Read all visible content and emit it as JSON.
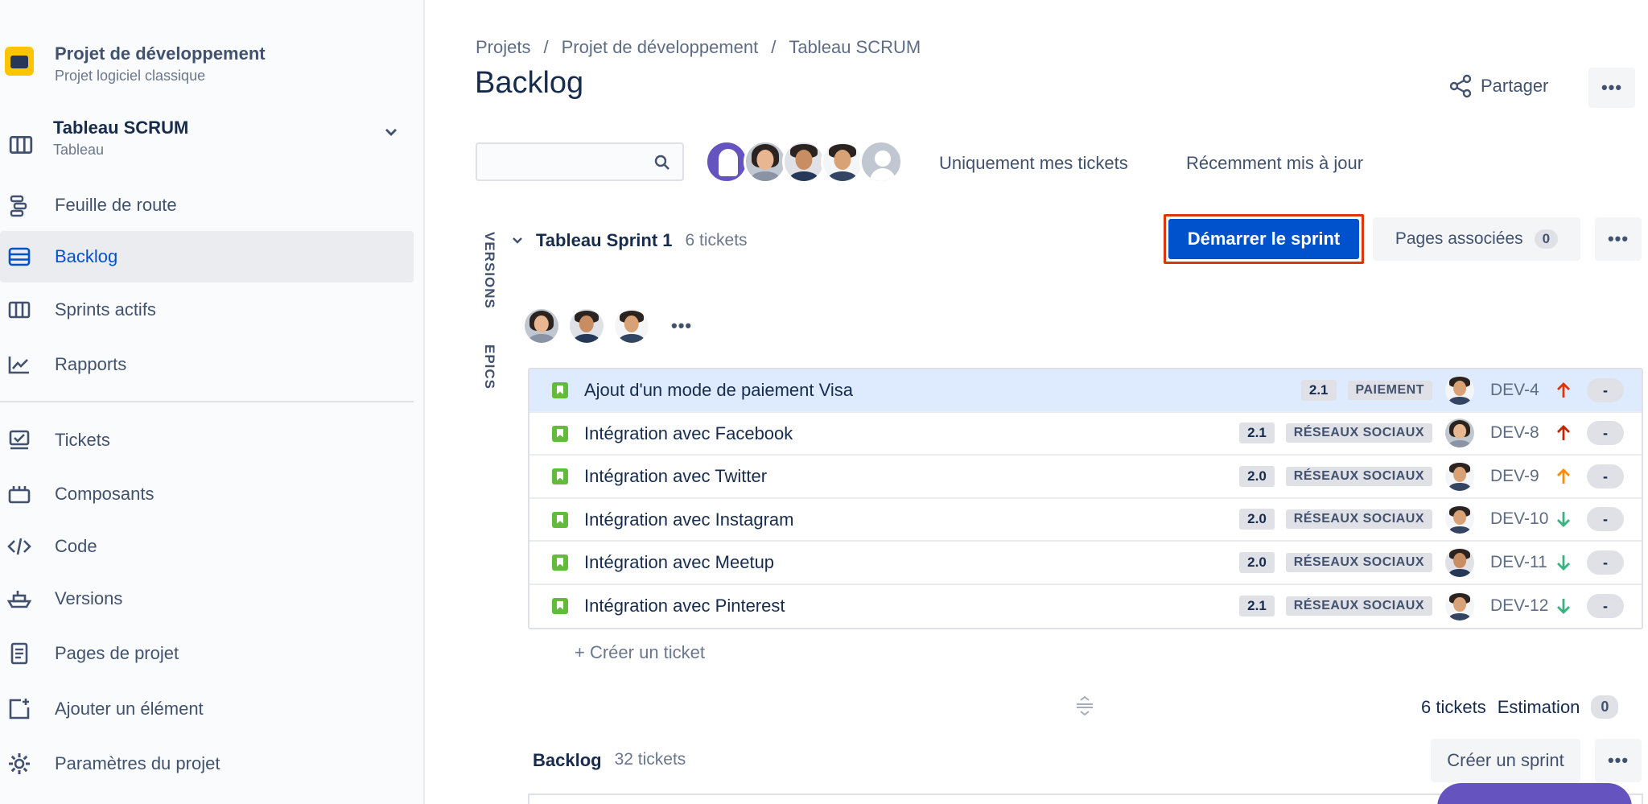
{
  "sidebar": {
    "project_name": "Projet de développement",
    "project_type": "Projet logiciel classique",
    "board_name": "Tableau SCRUM",
    "board_type": "Tableau",
    "nav": [
      {
        "label": "Feuille de route",
        "icon": "roadmap-icon"
      },
      {
        "label": "Backlog",
        "icon": "backlog-icon",
        "active": true
      },
      {
        "label": "Sprints actifs",
        "icon": "board-columns-icon"
      },
      {
        "label": "Rapports",
        "icon": "chart-line-icon"
      }
    ],
    "nav2": [
      {
        "label": "Tickets",
        "icon": "issues-icon"
      },
      {
        "label": "Composants",
        "icon": "components-icon"
      },
      {
        "label": "Code",
        "icon": "code-icon"
      },
      {
        "label": "Versions",
        "icon": "ship-icon"
      },
      {
        "label": "Pages de projet",
        "icon": "page-icon"
      },
      {
        "label": "Ajouter un élément",
        "icon": "add-item-icon"
      },
      {
        "label": "Paramètres du projet",
        "icon": "gear-icon"
      }
    ]
  },
  "header": {
    "breadcrumbs": [
      "Projets",
      "Projet de développement",
      "Tableau SCRUM"
    ],
    "separator": "/",
    "title": "Backlog",
    "share_label": "Partager",
    "more_label": "•••"
  },
  "filters": {
    "search_placeholder": "",
    "only_my_issues": "Uniquement mes tickets",
    "recently_updated": "Récemment mis à jour"
  },
  "side_tabs": {
    "versions": "VERSIONS",
    "epics": "EPICS"
  },
  "sprint": {
    "name": "Tableau Sprint 1",
    "count": "6 tickets",
    "start_label": "Démarrer le sprint",
    "linked_pages_label": "Pages associées",
    "linked_pages_count": "0",
    "more_label": "•••",
    "avatars_more": "•••",
    "issues": [
      {
        "title": "Ajout d'un mode de paiement Visa",
        "version": "2.1",
        "epic": "PAIEMENT",
        "key": "DEV-4",
        "priority": "high",
        "estimate": "-",
        "selected": true
      },
      {
        "title": "Intégration avec Facebook",
        "version": "2.1",
        "epic": "RÉSEAUX SOCIAUX",
        "key": "DEV-8",
        "priority": "highest",
        "estimate": "-"
      },
      {
        "title": "Intégration avec Twitter",
        "version": "2.0",
        "epic": "RÉSEAUX SOCIAUX",
        "key": "DEV-9",
        "priority": "medium",
        "estimate": "-"
      },
      {
        "title": "Intégration avec Instagram",
        "version": "2.0",
        "epic": "RÉSEAUX SOCIAUX",
        "key": "DEV-10",
        "priority": "low",
        "estimate": "-"
      },
      {
        "title": "Intégration avec Meetup",
        "version": "2.0",
        "epic": "RÉSEAUX SOCIAUX",
        "key": "DEV-11",
        "priority": "low",
        "estimate": "-"
      },
      {
        "title": "Intégration avec Pinterest",
        "version": "2.1",
        "epic": "RÉSEAUX SOCIAUX",
        "key": "DEV-12",
        "priority": "low",
        "estimate": "-"
      }
    ],
    "create_ticket": "+   Créer un ticket",
    "summary_count": "6 tickets",
    "summary_label": "Estimation",
    "summary_value": "0"
  },
  "backlog": {
    "name": "Backlog",
    "count": "32 tickets",
    "create_sprint_label": "Créer un sprint",
    "more_label": "•••"
  },
  "colors": {
    "primary": "#0052cc",
    "highlight_border": "#de350b",
    "story_green": "#63ba3c",
    "priority_high": "#de350b",
    "priority_medium": "#ff8b00",
    "priority_low": "#36b37e",
    "selected_row": "#deebff"
  }
}
